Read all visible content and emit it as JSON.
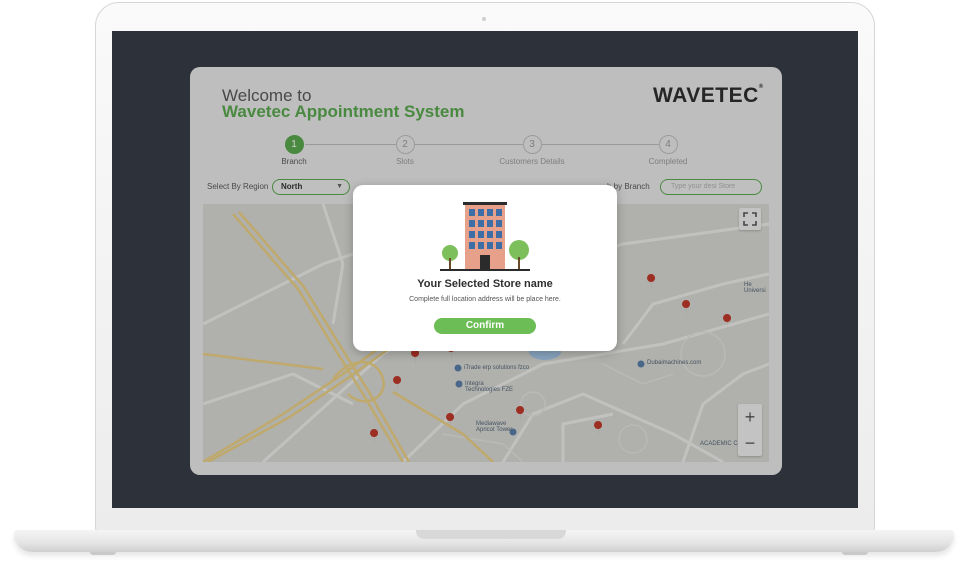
{
  "app": {
    "welcome": "Welcome to",
    "system_name": "Wavetec Appointment System",
    "logo": "WAVETEC"
  },
  "stepper": [
    {
      "num": "1",
      "label": "Branch",
      "active": true
    },
    {
      "num": "2",
      "label": "Slots",
      "active": false
    },
    {
      "num": "3",
      "label": "Customers Details",
      "active": false
    },
    {
      "num": "4",
      "label": "Completed",
      "active": false
    }
  ],
  "filters": {
    "region_label": "Select By Region",
    "region_value": "North",
    "branch_label": "h by Branch",
    "branch_placeholder": "Type your desi Store"
  },
  "map": {
    "labels": {
      "itrade": "iTrade erp solutions fzco",
      "integra": "Integra\nTechnologies FZE",
      "mediawave": "Mediawave\nApricot Tower",
      "dubaimachines": "Dubaimachines.com",
      "academic": "ACADEMIC C",
      "uni": "He\nUniversi"
    }
  },
  "modal": {
    "title": "Your Selected Store name",
    "address": "Complete full location address will be place here.",
    "confirm": "Confirm"
  },
  "colors": {
    "brand_green": "#5aa84f",
    "button_green": "#6cbd55",
    "screen_bg": "#2d313a",
    "pin_red": "#c0392b"
  }
}
